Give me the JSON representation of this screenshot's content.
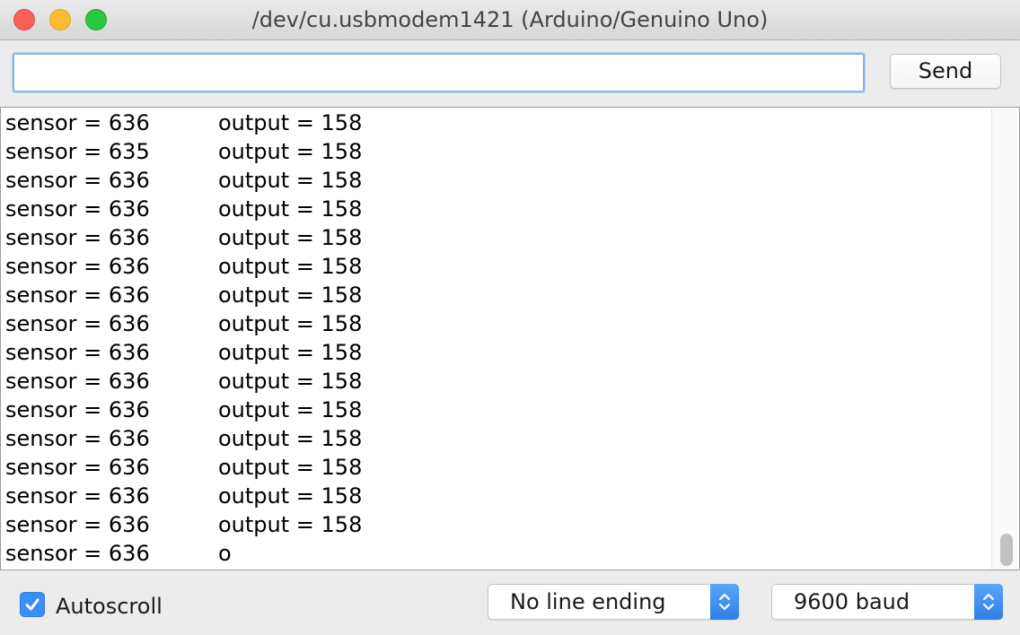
{
  "window": {
    "title": "/dev/cu.usbmodem1421 (Arduino/Genuino Uno)"
  },
  "input": {
    "value": "",
    "placeholder": ""
  },
  "send_button": {
    "label": "Send"
  },
  "output": {
    "lines": [
      {
        "sensor": "sensor = 636",
        "output": "output = 158"
      },
      {
        "sensor": "sensor = 635",
        "output": "output = 158"
      },
      {
        "sensor": "sensor = 636",
        "output": "output = 158"
      },
      {
        "sensor": "sensor = 636",
        "output": "output = 158"
      },
      {
        "sensor": "sensor = 636",
        "output": "output = 158"
      },
      {
        "sensor": "sensor = 636",
        "output": "output = 158"
      },
      {
        "sensor": "sensor = 636",
        "output": "output = 158"
      },
      {
        "sensor": "sensor = 636",
        "output": "output = 158"
      },
      {
        "sensor": "sensor = 636",
        "output": "output = 158"
      },
      {
        "sensor": "sensor = 636",
        "output": "output = 158"
      },
      {
        "sensor": "sensor = 636",
        "output": "output = 158"
      },
      {
        "sensor": "sensor = 636",
        "output": "output = 158"
      },
      {
        "sensor": "sensor = 636",
        "output": "output = 158"
      },
      {
        "sensor": "sensor = 636",
        "output": "output = 158"
      },
      {
        "sensor": "sensor = 636",
        "output": "output = 158"
      },
      {
        "sensor": "sensor = 636",
        "output": "o"
      }
    ]
  },
  "bottom_bar": {
    "autoscroll_label": "Autoscroll",
    "autoscroll_checked": true,
    "line_ending": "No line ending",
    "baud_rate": "9600 baud"
  },
  "colors": {
    "accent": "#3b8ef4",
    "close": "#fc5f57",
    "minimize": "#fdbc2e",
    "zoom": "#29c83f"
  },
  "icons": {
    "close": "close-icon",
    "minimize": "minimize-icon",
    "zoom": "zoom-icon",
    "checkbox": "checkmark-icon",
    "select_arrows": "updown-chevron-icon"
  }
}
